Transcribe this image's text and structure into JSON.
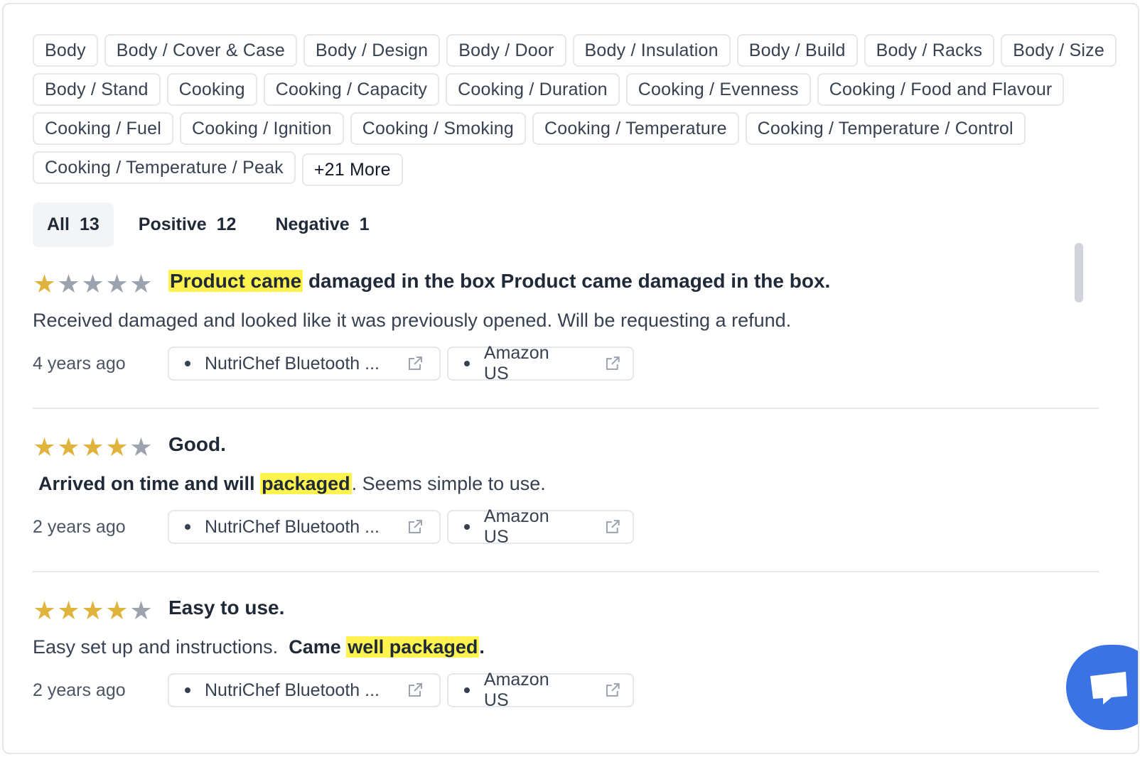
{
  "tags": {
    "rows": [
      [
        "Body",
        "Body / Cover & Case",
        "Body / Design",
        "Body / Door",
        "Body / Insulation",
        "Body / Build",
        "Body / Racks",
        "Body / Size"
      ],
      [
        "Body / Stand",
        "Cooking",
        "Cooking / Capacity",
        "Cooking / Duration",
        "Cooking / Evenness",
        "Cooking / Food and Flavour"
      ],
      [
        "Cooking / Fuel",
        "Cooking / Ignition",
        "Cooking / Smoking",
        "Cooking / Temperature",
        "Cooking / Temperature / Control"
      ],
      [
        "Cooking / Temperature / Peak"
      ]
    ],
    "more_label": "+21 More"
  },
  "filters": [
    {
      "label": "All",
      "count": "13",
      "active": true
    },
    {
      "label": "Positive",
      "count": "12",
      "active": false
    },
    {
      "label": "Negative",
      "count": "1",
      "active": false
    }
  ],
  "reviews": [
    {
      "rating": 1,
      "title_highlight": "Product came",
      "title_rest": " damaged in the box Product came damaged in the box.",
      "body_plain": "Received damaged and looked like it was previously opened. Will be requesting a refund.",
      "age": "4 years ago",
      "product": "NutriChef Bluetooth ...",
      "store": "Amazon US"
    },
    {
      "rating": 4,
      "title": "Good.",
      "body_bold": "Arrived on time and will ",
      "body_highlight": "packaged",
      "body_rest": ". Seems simple to use.",
      "age": "2 years ago",
      "product": "NutriChef Bluetooth ...",
      "store": "Amazon US"
    },
    {
      "rating": 4,
      "title": "Easy to use.",
      "body_plain": "Easy set up and instructions.  ",
      "body_bold": "Came ",
      "body_highlight": "well packaged",
      "body_end": ".",
      "age": "2 years ago",
      "product": "NutriChef Bluetooth ...",
      "store": "Amazon US"
    }
  ],
  "colors": {
    "star_on": "#e0b43c",
    "star_off": "#9ca3af",
    "highlight": "#fff44f",
    "chat_button": "#3b73e5"
  },
  "icons": {
    "external_link": "external-link-icon",
    "chat": "chat-bubble-icon",
    "star": "star-icon"
  }
}
